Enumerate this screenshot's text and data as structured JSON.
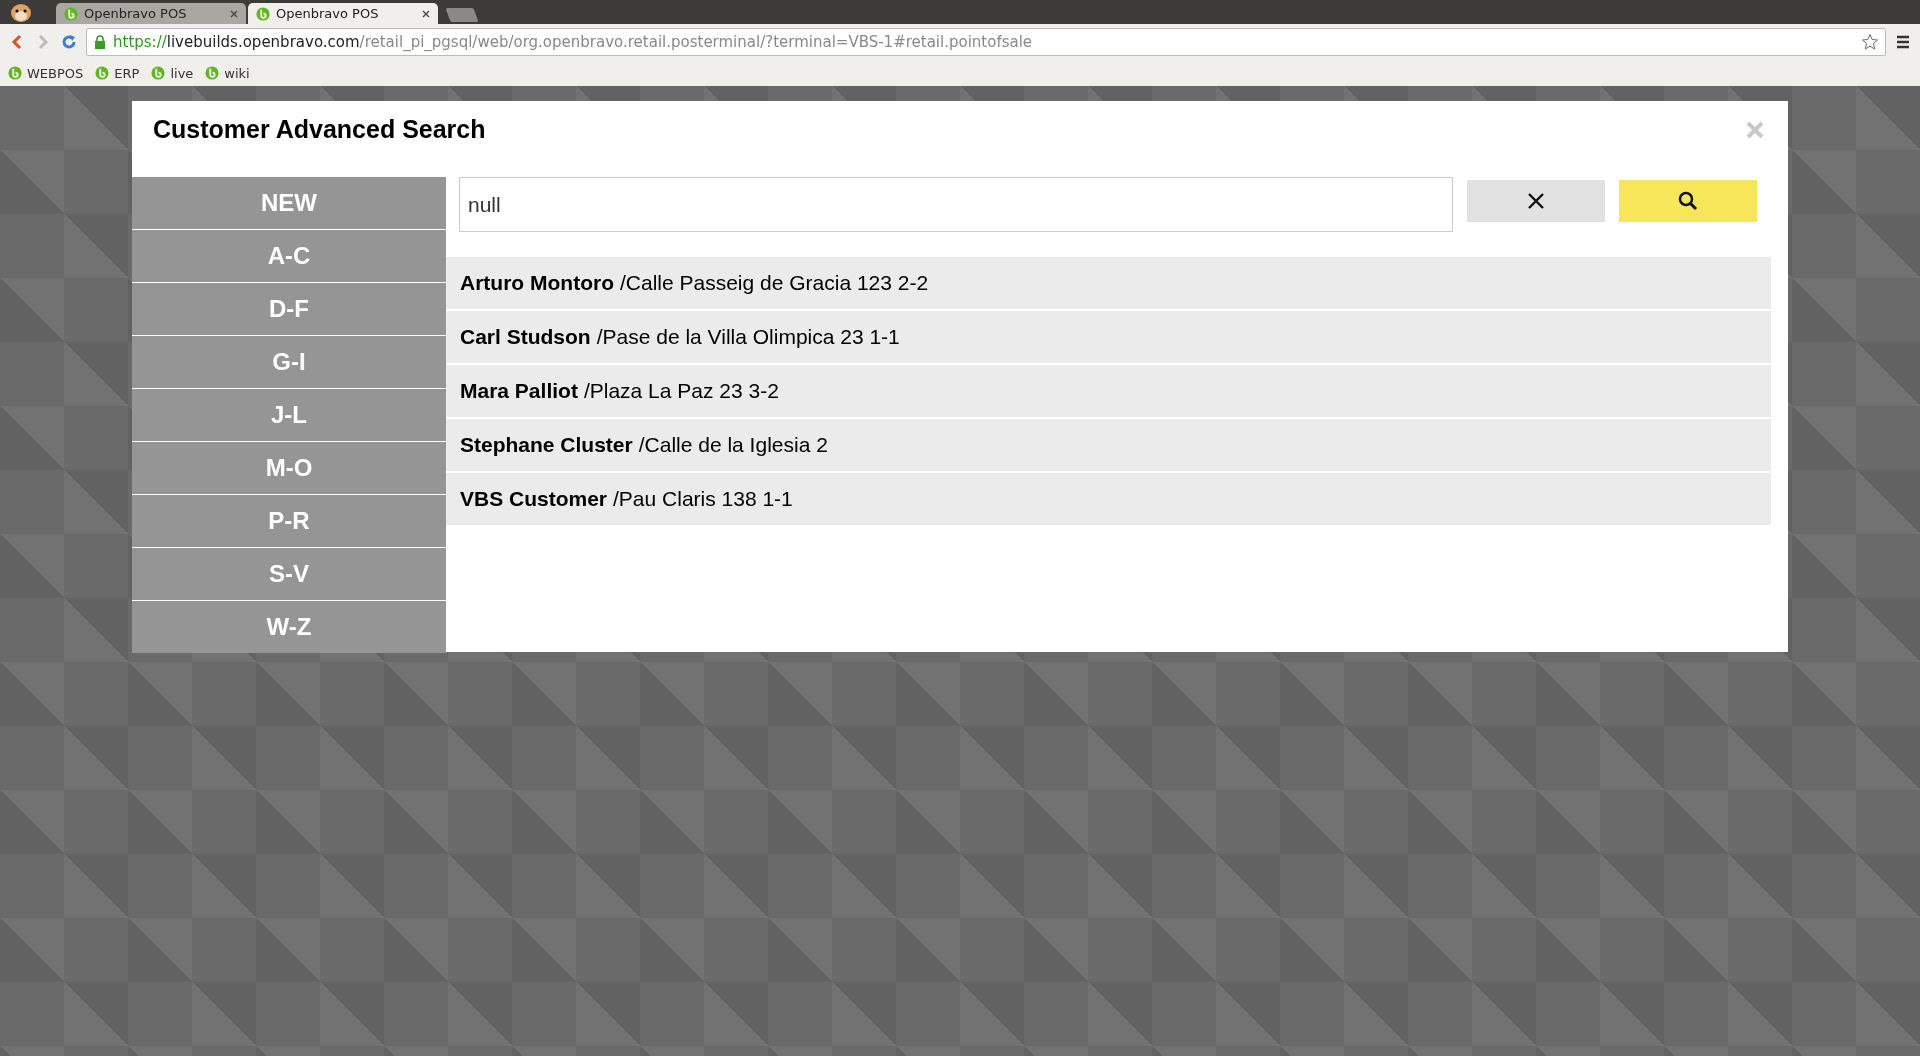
{
  "browser": {
    "tabs": [
      {
        "title": "Openbravo POS",
        "selected": false
      },
      {
        "title": "Openbravo POS",
        "selected": true
      }
    ],
    "url": {
      "scheme": "https://",
      "host": "livebuilds.openbravo.com",
      "path": "/retail_pi_pgsql/web/org.openbravo.retail.posterminal/?terminal=VBS-1#retail.pointofsale"
    },
    "bookmarks": [
      "WEBPOS",
      "ERP",
      "live",
      "wiki"
    ]
  },
  "dialog": {
    "title": "Customer Advanced Search",
    "filters": [
      "NEW",
      "A-C",
      "D-F",
      "G-I",
      "J-L",
      "M-O",
      "P-R",
      "S-V",
      "W-Z"
    ],
    "search": {
      "value": "null"
    },
    "results": [
      {
        "name": "Arturo Montoro",
        "address": "/Calle Passeig de Gracia 123 2-2"
      },
      {
        "name": "Carl Studson",
        "address": "/Pase de la Villa Olimpica 23 1-1"
      },
      {
        "name": "Mara Palliot",
        "address": "/Plaza La Paz 23 3-2"
      },
      {
        "name": "Stephane Cluster",
        "address": "/Calle de la Iglesia 2"
      },
      {
        "name": "VBS Customer",
        "address": "/Pau Claris 138 1-1"
      }
    ]
  }
}
